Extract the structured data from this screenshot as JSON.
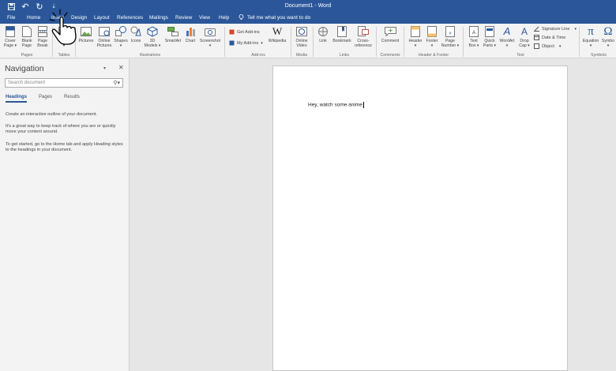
{
  "window": {
    "title": "Document1 - Word"
  },
  "qat": {
    "save_icon": "save-icon",
    "undo_glyph": "↶",
    "redo_glyph": "↻",
    "more_glyph": "⇣"
  },
  "tabs": [
    {
      "label": "File"
    },
    {
      "label": "Home"
    },
    {
      "label": "Insert"
    },
    {
      "label": "Design"
    },
    {
      "label": "Layout"
    },
    {
      "label": "References"
    },
    {
      "label": "Mailings"
    },
    {
      "label": "Review"
    },
    {
      "label": "View"
    },
    {
      "label": "Help"
    }
  ],
  "tellme": {
    "label": "Tell me what you want to do"
  },
  "ribbon": {
    "pages": {
      "cover": "Cover\nPage ▾",
      "blank": "Blank\nPage",
      "break": "Page\nBreak",
      "group": "Pages"
    },
    "tables": {
      "table": "Table\n▾",
      "group": "Tables"
    },
    "illustrations": {
      "pictures": "Pictures",
      "online_pictures": "Online\nPictures",
      "shapes": "Shapes\n▾",
      "icons": "Icons",
      "models": "3D\nModels ▾",
      "smartart": "SmartArt",
      "chart": "Chart",
      "screenshot": "Screenshot\n▾",
      "group": "Illustrations"
    },
    "addins": {
      "get": "Get Add-ins",
      "my": "My Add-ins",
      "wikipedia": "Wikipedia",
      "group": "Add-ins"
    },
    "media": {
      "online_video": "Online\nVideo",
      "group": "Media"
    },
    "links": {
      "link": "Link",
      "bookmark": "Bookmark",
      "crossref": "Cross-\nreference",
      "group": "Links"
    },
    "comments": {
      "comment": "Comment",
      "group": "Comments"
    },
    "header_footer": {
      "header": "Header\n▾",
      "footer": "Footer\n▾",
      "page_number": "Page\nNumber ▾",
      "group": "Header & Footer"
    },
    "text": {
      "textbox": "Text\nBox ▾",
      "quickparts": "Quick\nParts ▾",
      "wordart": "WordArt\n▾",
      "dropcap": "Drop\nCap ▾",
      "signature": "Signature Line",
      "datetime": "Date & Time",
      "object": "Object",
      "group": "Text"
    },
    "symbols": {
      "equation": "Equation\n▾",
      "symbol": "Symbo\n▾",
      "group": "Symbols"
    }
  },
  "nav": {
    "title": "Navigation",
    "search_placeholder": "Search document",
    "tabs": [
      "Headings",
      "Pages",
      "Results"
    ],
    "text1": "Create an interactive outline of your document.",
    "text2": "It's a great way to keep track of where you are or quickly move your content around.",
    "text3": "To get started, go to the Home tab and apply Heading styles to the headings in your document."
  },
  "document": {
    "body_text": "Hey, watch some anime"
  },
  "colors": {
    "accent": "#2b579a",
    "ribbon_bg": "#f3f3f3",
    "canvas_bg": "#e6e6e6"
  }
}
